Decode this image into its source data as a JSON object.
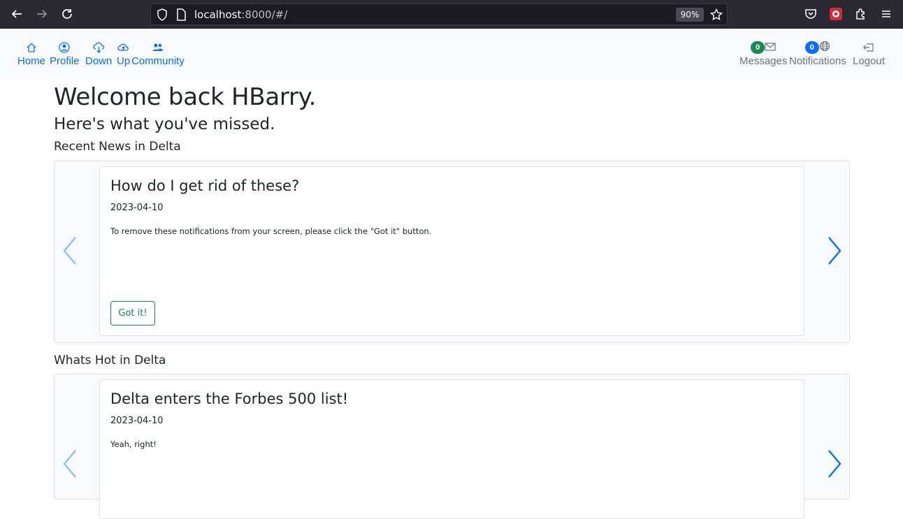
{
  "browser": {
    "url_host": "localhost",
    "url_rest": ":8000/#/",
    "zoom": "90%"
  },
  "nav": {
    "left": [
      {
        "label": "Home",
        "icon": "house-icon"
      },
      {
        "label": "Profile",
        "icon": "person-circle-icon"
      },
      {
        "label": "Down",
        "icon": "cloud-download-icon"
      },
      {
        "label": "Up",
        "icon": "cloud-upload-icon"
      },
      {
        "label": "Community",
        "icon": "people-icon"
      }
    ],
    "right": [
      {
        "label": "Messages",
        "icon": "envelope-icon",
        "badge": "0",
        "badge_color": "#198754"
      },
      {
        "label": "Notifications",
        "icon": "globe-icon",
        "badge": "0",
        "badge_color": "#0d6efd"
      },
      {
        "label": "Logout",
        "icon": "box-arrow-left-icon"
      }
    ]
  },
  "page": {
    "welcome": "Welcome back HBarry.",
    "subtitle": "Here's what you've missed."
  },
  "news": {
    "heading": "Recent News in Delta",
    "card": {
      "title": "How do I get rid of these?",
      "date": "2023-04-10",
      "text": "To remove these notifications from your screen, please click the \"Got it\" button.",
      "button": "Got it!"
    }
  },
  "hot": {
    "heading": "Whats Hot in Delta",
    "card": {
      "title": "Delta enters the Forbes 500 list!",
      "date": "2023-04-10",
      "text": "Yeah, right!"
    }
  },
  "colors": {
    "primary": "#0d6efd",
    "success": "#198754",
    "muted": "#6c757d"
  }
}
